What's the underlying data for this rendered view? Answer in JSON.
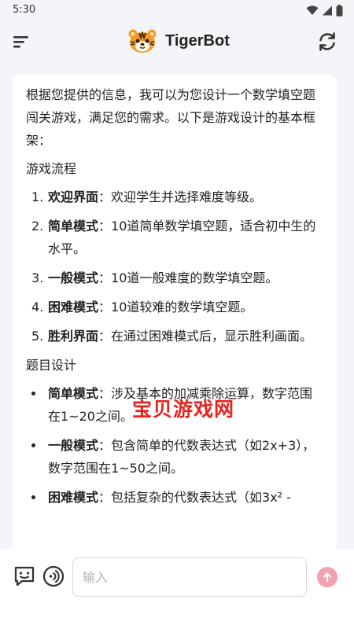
{
  "status_bar": {
    "time": "5:30"
  },
  "header": {
    "title": "TigerBot"
  },
  "chat": {
    "intro": "根据您提供的信息，我可以为您设计一个数学填空题闯关游戏，满足您的需求。以下是游戏设计的基本框架：",
    "flow_title": "游戏流程",
    "flow_steps": [
      {
        "num": "1.",
        "label": "欢迎界面",
        "sep": "：",
        "text": "欢迎学生并选择难度等级。"
      },
      {
        "num": "2.",
        "label": "简单模式",
        "sep": "：",
        "text": "10道简单数学填空题，适合初中生的水平。"
      },
      {
        "num": "3.",
        "label": "一般模式",
        "sep": "：",
        "text": "10道一般难度的数学填空题。"
      },
      {
        "num": "4.",
        "label": "困难模式",
        "sep": "：",
        "text": "10道较难的数学填空题。"
      },
      {
        "num": "5.",
        "label": "胜利界面",
        "sep": "：",
        "text": "在通过困难模式后，显示胜利画面。"
      }
    ],
    "design_title": "题目设计",
    "design_items": [
      {
        "label": "简单模式",
        "sep": "：",
        "text": "涉及基本的加减乘除运算，数字范围在1~20之间。"
      },
      {
        "label": "一般模式",
        "sep": "：",
        "text": "包含简单的代数表达式（如2x+3），数字范围在1~50之间。"
      },
      {
        "label": "困难模式",
        "sep": "：",
        "text": "包括复杂的代数表达式（如3x² -"
      }
    ],
    "watermark": "宝贝游戏网"
  },
  "input_bar": {
    "placeholder": "输入"
  },
  "colors": {
    "accent": "#f3a2ad",
    "background": "#f4f5f9",
    "bubble": "#ffffff",
    "watermark": "#e8231f"
  },
  "icons": [
    "wifi-icon",
    "signal-icon",
    "battery-icon",
    "menu-icon",
    "tiger-logo-icon",
    "refresh-icon",
    "feedback-icon",
    "voice-icon",
    "send-arrow-icon"
  ]
}
